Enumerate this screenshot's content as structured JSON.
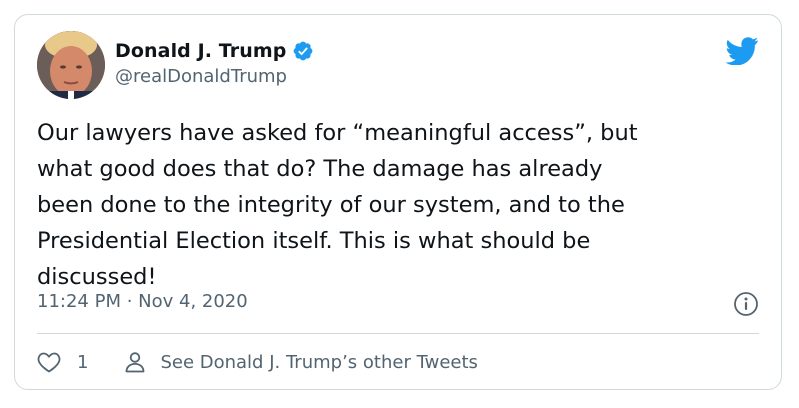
{
  "tweet": {
    "author": {
      "display_name": "Donald J. Trump",
      "handle": "@realDonaldTrump",
      "verified_icon": "verified-badge-icon",
      "avatar": "profile-photo"
    },
    "text": "Our lawyers have asked for “meaningful access”, but\nwhat good does that do? The damage has already\nbeen done to the integrity of our system, and to the\nPresidential Election itself. This is what should be\ndiscussed!",
    "timestamp": "11:24 PM · Nov 4, 2020",
    "like_count": "1",
    "other_tweets_label": "See Donald J. Trump’s other Tweets"
  },
  "icons": {
    "brand": "twitter-bird-icon",
    "info": "info-icon",
    "like": "heart-icon",
    "profile": "person-icon"
  },
  "colors": {
    "brand": "#1d9bf0",
    "text": "#0f1419",
    "secondary": "#536471",
    "border": "#cfd9de"
  }
}
